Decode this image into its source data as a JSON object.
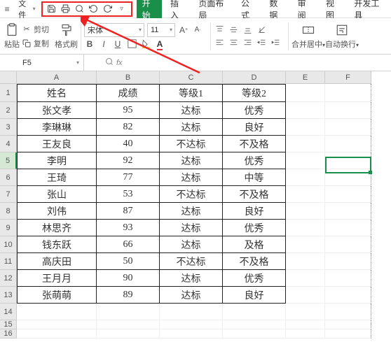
{
  "menubar": {
    "file": "文件"
  },
  "tabs": {
    "start": "开始",
    "insert": "插入",
    "layout": "页面布局",
    "formula": "公式",
    "data": "数据",
    "review": "审阅",
    "view": "视图",
    "dev": "开发工具"
  },
  "ribbon": {
    "cut": "剪切",
    "copy": "复制",
    "format_painter": "格式刷",
    "paste": "粘贴",
    "font_name": "宋体",
    "font_size": "11",
    "merge": "合并居中",
    "wrap": "自动换行"
  },
  "formula_bar": {
    "name_box": "F5",
    "fx": "fx"
  },
  "columns": [
    "A",
    "B",
    "C",
    "D",
    "E",
    "F"
  ],
  "selected_cell": "F5",
  "chart_data": {
    "type": "table",
    "headers": [
      "姓名",
      "成绩",
      "等级1",
      "等级2"
    ],
    "rows": [
      [
        "张文孝",
        "95",
        "达标",
        "优秀"
      ],
      [
        "李琳琳",
        "82",
        "达标",
        "良好"
      ],
      [
        "王友良",
        "40",
        "不达标",
        "不及格"
      ],
      [
        "李明",
        "92",
        "达标",
        "优秀"
      ],
      [
        "王琦",
        "77",
        "达标",
        "中等"
      ],
      [
        "张山",
        "53",
        "不达标",
        "不及格"
      ],
      [
        "刘伟",
        "87",
        "达标",
        "良好"
      ],
      [
        "林思齐",
        "93",
        "达标",
        "优秀"
      ],
      [
        "钱东跃",
        "66",
        "达标",
        "及格"
      ],
      [
        "高庆田",
        "50",
        "不达标",
        "不及格"
      ],
      [
        "王月月",
        "90",
        "达标",
        "优秀"
      ],
      [
        "张萌萌",
        "89",
        "达标",
        "良好"
      ]
    ]
  },
  "row_numbers": [
    "1",
    "2",
    "3",
    "4",
    "5",
    "6",
    "7",
    "8",
    "9",
    "10",
    "11",
    "12",
    "13",
    "14",
    "15",
    "16"
  ]
}
